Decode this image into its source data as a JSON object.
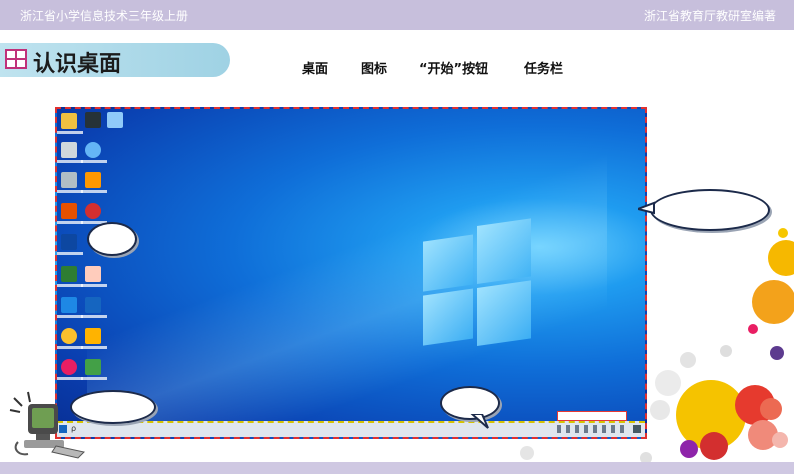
{
  "header": {
    "left_text": "浙江省小学信息技术三年级上册",
    "right_text": "浙江省教育厅教研室编著"
  },
  "lesson": {
    "title": "认识桌面",
    "title_icon": "window-grid-icon"
  },
  "vocabulary": [
    "桌面",
    "图标",
    "“开始”按钮",
    "任务栏"
  ],
  "screenshot": {
    "os": "Windows 10 desktop",
    "taskbar_search_glyph": "ρ"
  },
  "colors": {
    "banner": "#c7bfdc",
    "frame_dash": "#e03030",
    "taskbar_dash": "#d7c400",
    "bubble_border": "#1c2a4a"
  }
}
